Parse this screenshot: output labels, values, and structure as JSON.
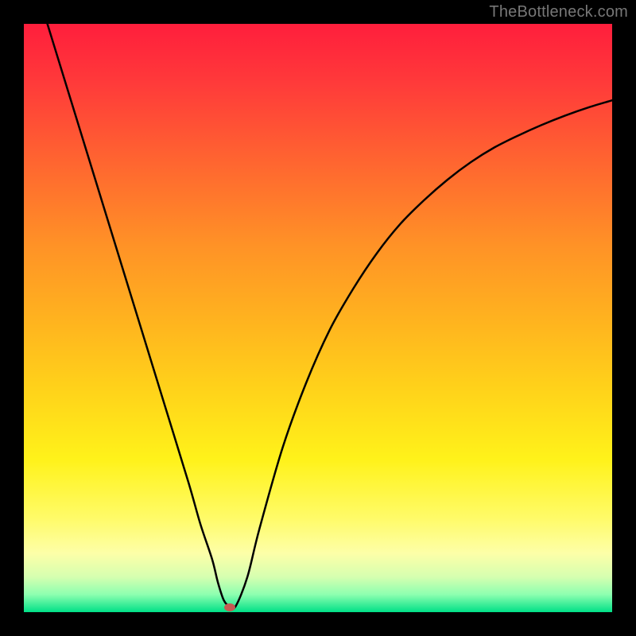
{
  "watermark": "TheBottleneck.com",
  "colors": {
    "curve": "#000000",
    "marker": "#c65a53",
    "frame": "#000000"
  },
  "chart_data": {
    "type": "line",
    "title": "",
    "xlabel": "",
    "ylabel": "",
    "xlim": [
      0,
      100
    ],
    "ylim": [
      0,
      100
    ],
    "grid": false,
    "legend": false,
    "series": [
      {
        "name": "bottleneck-curve",
        "x": [
          0,
          4,
          8,
          12,
          16,
          20,
          24,
          28,
          30,
          32,
          33,
          34,
          35,
          36,
          38,
          40,
          44,
          48,
          52,
          56,
          60,
          64,
          68,
          72,
          76,
          80,
          84,
          88,
          92,
          96,
          100
        ],
        "y": [
          113,
          100,
          87,
          74,
          61,
          48,
          35,
          22,
          15,
          9,
          5,
          2,
          1,
          1,
          6,
          14,
          28,
          39,
          48,
          55,
          61,
          66,
          70,
          73.5,
          76.5,
          79,
          81,
          82.8,
          84.4,
          85.8,
          87
        ]
      }
    ],
    "annotations": [
      {
        "name": "min-marker",
        "x": 35,
        "y": 0.8
      }
    ]
  }
}
